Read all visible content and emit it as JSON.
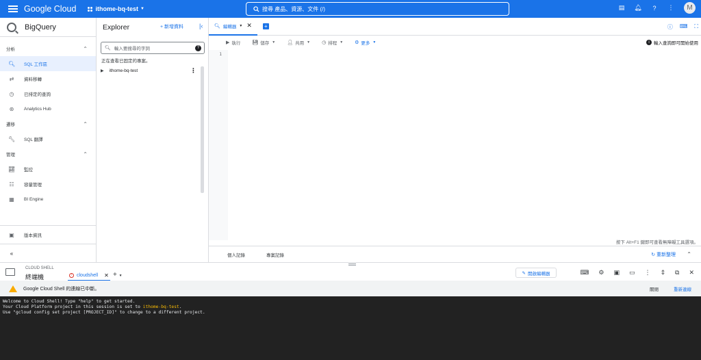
{
  "topbar": {
    "brand": "Google Cloud",
    "project": "ithome-bq-test",
    "search_placeholder": "搜尋 產品、資源、文件 (/)",
    "avatar_letter": "M"
  },
  "sidebar": {
    "title": "BigQuery",
    "sections": [
      {
        "label": "分析",
        "items": [
          "SQL 工作區",
          "資料移轉",
          "已排定的查詢",
          "Analytics Hub"
        ]
      },
      {
        "label": "遷移",
        "items": [
          "SQL 翻譯"
        ]
      },
      {
        "label": "管理",
        "items": [
          "監控",
          "容量管理",
          "BI Engine"
        ]
      }
    ],
    "footer": "版本資訊"
  },
  "explorer": {
    "title": "Explorer",
    "add_data": "+ 新增資料",
    "search_placeholder": "輸入要搜尋的字詞",
    "note": "正在查看已固定的專案。",
    "project": "ithome-bq-test"
  },
  "editor": {
    "tab_label": "編輯器",
    "toolbar": {
      "run": "執行",
      "save": "儲存",
      "share": "共用",
      "schedule": "排程",
      "more": "更多"
    },
    "hint": "輸入查詢即可開始使用",
    "line_number": "1",
    "kbd_hint": "按下 Alt+F1 鍵即可查看無障礙工具選項。",
    "history": {
      "personal": "個人記錄",
      "project": "專案記錄",
      "refresh": "重新整理"
    }
  },
  "shell": {
    "label": "CLOUD SHELL",
    "title": "終端機",
    "tab": "cloudshell",
    "open_editor": "開啟編輯器",
    "warning": "Google Cloud Shell 的連線已中斷。",
    "close": "關閉",
    "reconnect": "重新連線",
    "terminal": {
      "line1": "Welcome to Cloud Shell! Type \"help\" to get started.",
      "line2_prefix": "Your Cloud Platform project in this session is set to ",
      "line2_project": "ithome-bq-test",
      "line2_suffix": ".",
      "line3": "Use \"gcloud config set project [PROJECT_ID]\" to change to a different project."
    }
  }
}
